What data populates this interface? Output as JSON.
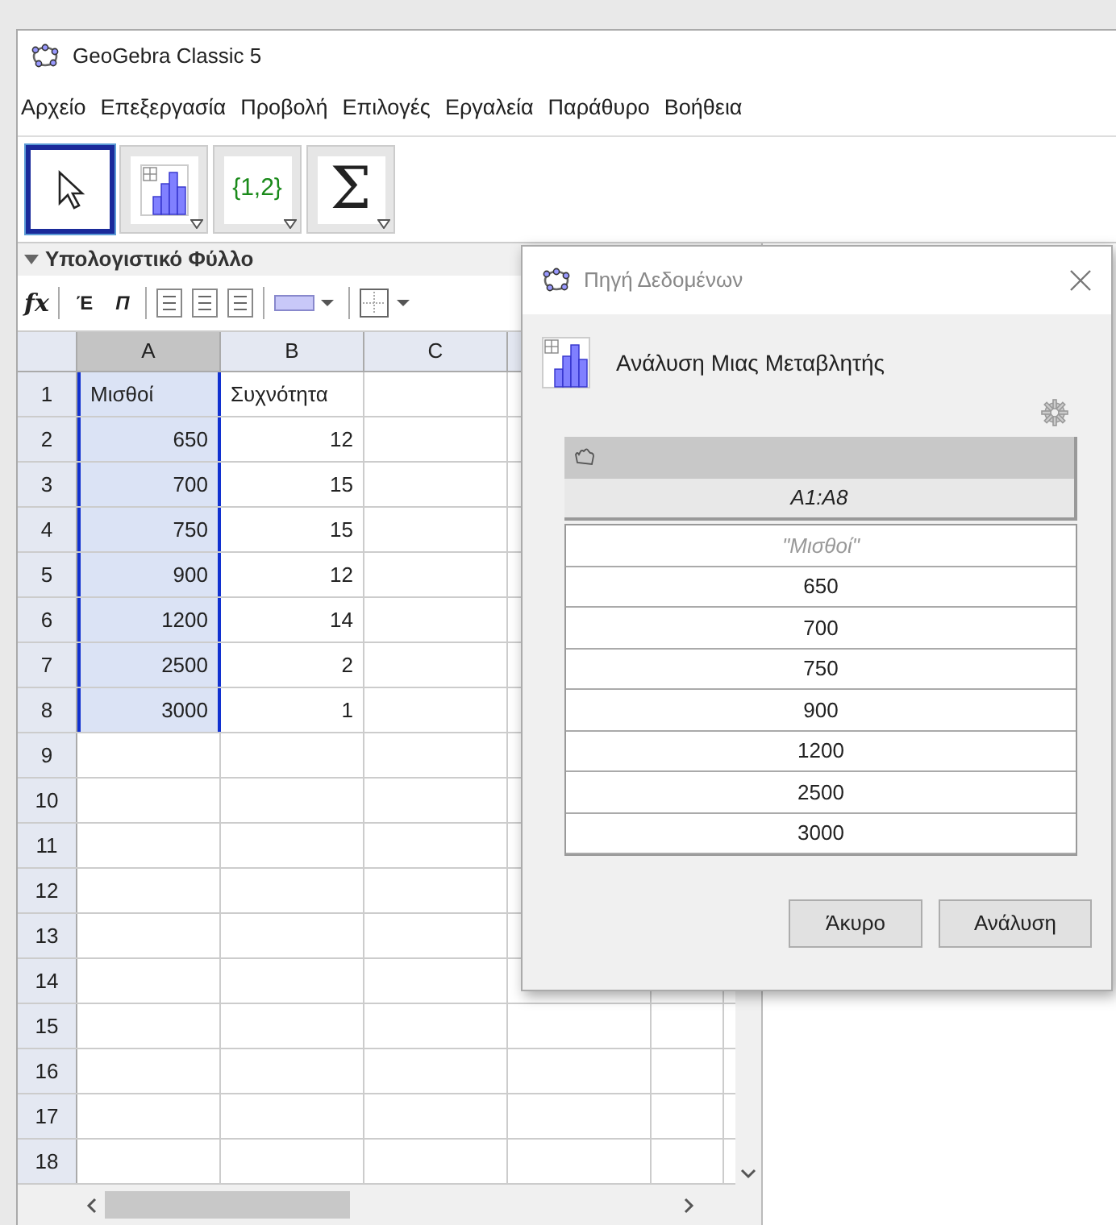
{
  "window": {
    "title": "GeoGebra Classic 5"
  },
  "menu": [
    "Αρχείο",
    "Επεξεργασία",
    "Προβολή",
    "Επιλογές",
    "Εργαλεία",
    "Παράθυρο",
    "Βοήθεια"
  ],
  "toolbar": [
    {
      "kind": "move",
      "selected": true
    },
    {
      "kind": "analysis",
      "selected": false
    },
    {
      "kind": "list",
      "label": "{1,2}",
      "selected": false
    },
    {
      "kind": "sum",
      "label": "Σ",
      "selected": false
    }
  ],
  "spreadsheet": {
    "title": "Υπολογιστικό Φύλλο",
    "style_bar": {
      "formula": "fx",
      "bold": "Έ",
      "italic": "Π"
    },
    "columns": [
      {
        "label": "A",
        "selected": true
      },
      {
        "label": "B",
        "selected": false
      },
      {
        "label": "C",
        "selected": false
      }
    ],
    "rows": [
      {
        "label": "1",
        "cells": [
          {
            "text": "Μισθοί",
            "kind": "text",
            "selected": true
          },
          {
            "text": "Συχνότητα",
            "kind": "text",
            "selected": false
          }
        ]
      },
      {
        "label": "2",
        "cells": [
          {
            "text": "650",
            "kind": "number",
            "selected": true
          },
          {
            "text": "12",
            "kind": "number",
            "selected": false
          }
        ]
      },
      {
        "label": "3",
        "cells": [
          {
            "text": "700",
            "kind": "number",
            "selected": true
          },
          {
            "text": "15",
            "kind": "number",
            "selected": false
          }
        ]
      },
      {
        "label": "4",
        "cells": [
          {
            "text": "750",
            "kind": "number",
            "selected": true
          },
          {
            "text": "15",
            "kind": "number",
            "selected": false
          }
        ]
      },
      {
        "label": "5",
        "cells": [
          {
            "text": "900",
            "kind": "number",
            "selected": true
          },
          {
            "text": "12",
            "kind": "number",
            "selected": false
          }
        ]
      },
      {
        "label": "6",
        "cells": [
          {
            "text": "1200",
            "kind": "number",
            "selected": true
          },
          {
            "text": "14",
            "kind": "number",
            "selected": false
          }
        ]
      },
      {
        "label": "7",
        "cells": [
          {
            "text": "2500",
            "kind": "number",
            "selected": true
          },
          {
            "text": "2",
            "kind": "number",
            "selected": false
          }
        ]
      },
      {
        "label": "8",
        "cells": [
          {
            "text": "3000",
            "kind": "number",
            "selected": true
          },
          {
            "text": "1",
            "kind": "number",
            "selected": false
          }
        ]
      },
      {
        "label": "9",
        "cells": []
      },
      {
        "label": "10",
        "cells": []
      },
      {
        "label": "11",
        "cells": []
      },
      {
        "label": "12",
        "cells": []
      },
      {
        "label": "13",
        "cells": []
      },
      {
        "label": "14",
        "cells": []
      },
      {
        "label": "15",
        "cells": []
      },
      {
        "label": "16",
        "cells": []
      },
      {
        "label": "17",
        "cells": []
      },
      {
        "label": "18",
        "cells": []
      }
    ]
  },
  "dialog": {
    "title": "Πηγή Δεδομένων",
    "heading": "Ανάλυση Μιας Μεταβλητής",
    "source": "A1:A8",
    "values": [
      {
        "text": "\"Μισθοί\"",
        "kind": "title"
      },
      {
        "text": "650",
        "kind": "value"
      },
      {
        "text": "700",
        "kind": "value"
      },
      {
        "text": "750",
        "kind": "value"
      },
      {
        "text": "900",
        "kind": "value"
      },
      {
        "text": "1200",
        "kind": "value"
      },
      {
        "text": "2500",
        "kind": "value"
      },
      {
        "text": "3000",
        "kind": "value"
      }
    ],
    "buttons": [
      "Άκυρο",
      "Ανάλυση"
    ]
  }
}
